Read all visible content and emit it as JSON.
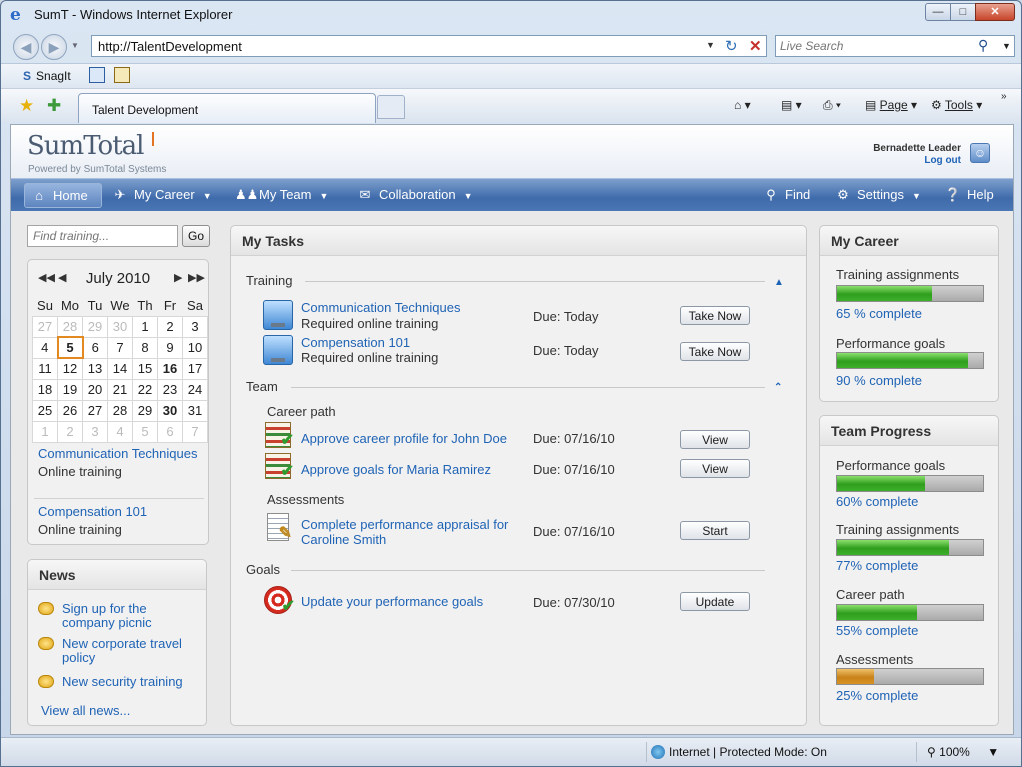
{
  "browser": {
    "title": "SumT  - Windows Internet Explorer",
    "url": "http://TalentDevelopment",
    "live_search_placeholder": "Live Search",
    "snagit_label": "SnagIt",
    "tab_label": "Talent Development",
    "page_menu": "Page",
    "tools_menu": "Tools",
    "status_zone": "Internet | Protected Mode: On",
    "zoom": "100%"
  },
  "header": {
    "logo_text": "SumTotal",
    "powered_by": "Powered by SumTotal Systems",
    "user_name": "Bernadette Leader",
    "logout": "Log out"
  },
  "nav": {
    "home": "Home",
    "my_career": "My Career",
    "my_team": "My Team",
    "collaboration": "Collaboration",
    "find": "Find",
    "settings": "Settings",
    "help": "Help"
  },
  "search": {
    "placeholder": "Find training...",
    "go": "Go"
  },
  "calendar": {
    "month": "July 2010",
    "weekdays": [
      "Su",
      "Mo",
      "Tu",
      "We",
      "Th",
      "Fr",
      "Sa"
    ],
    "weeks": [
      [
        "27",
        "28",
        "29",
        "30",
        "1",
        "2",
        "3"
      ],
      [
        "4",
        "5",
        "6",
        "7",
        "8",
        "9",
        "10"
      ],
      [
        "11",
        "12",
        "13",
        "14",
        "15",
        "16",
        "17"
      ],
      [
        "18",
        "19",
        "20",
        "21",
        "22",
        "23",
        "24"
      ],
      [
        "25",
        "26",
        "27",
        "28",
        "29",
        "30",
        "31"
      ],
      [
        "1",
        "2",
        "3",
        "4",
        "5",
        "6",
        "7"
      ]
    ],
    "events": [
      {
        "title": "Communication Techniques",
        "type": "Online training"
      },
      {
        "title": "Compensation 101",
        "type": "Online training"
      }
    ]
  },
  "news": {
    "title": "News",
    "items": [
      "Sign up for the company picnic",
      "New corporate travel policy",
      "New security training"
    ],
    "view_all": "View all news..."
  },
  "tasks": {
    "title": "My Tasks",
    "training": {
      "label": "Training",
      "items": [
        {
          "title": "Communication Techniques",
          "sub": "Required online training",
          "due": "Due: Today",
          "action": "Take Now"
        },
        {
          "title": "Compensation 101",
          "sub": "Required online training",
          "due": "Due: Today",
          "action": "Take Now"
        }
      ]
    },
    "team": {
      "label": "Team",
      "career_path_label": "Career path",
      "career_items": [
        {
          "title": "Approve career profile for John Doe",
          "due": "Due: 07/16/10",
          "action": "View"
        },
        {
          "title": "Approve goals for Maria Ramirez",
          "due": "Due: 07/16/10",
          "action": "View"
        }
      ],
      "assessments_label": "Assessments",
      "assessment_item": {
        "title_line1": "Complete performance appraisal for",
        "title_line2": "Caroline Smith",
        "due": "Due: 07/16/10",
        "action": "Start"
      }
    },
    "goals": {
      "label": "Goals",
      "item": {
        "title": "Update your performance goals",
        "due": "Due: 07/30/10",
        "action": "Update"
      }
    }
  },
  "my_career": {
    "title": "My Career",
    "items": [
      {
        "label": "Training assignments",
        "percent": 65,
        "text": "65 % complete"
      },
      {
        "label": "Performance goals",
        "percent": 90,
        "text": "90 % complete"
      }
    ]
  },
  "team_progress": {
    "title": "Team Progress",
    "items": [
      {
        "label": "Performance goals",
        "percent": 60,
        "text": "60% complete",
        "color": "green"
      },
      {
        "label": "Training assignments",
        "percent": 77,
        "text": "77% complete",
        "color": "green"
      },
      {
        "label": "Career path",
        "percent": 55,
        "text": "55% complete",
        "color": "green"
      },
      {
        "label": "Assessments",
        "percent": 25,
        "text": "25% complete",
        "color": "orange"
      }
    ]
  }
}
